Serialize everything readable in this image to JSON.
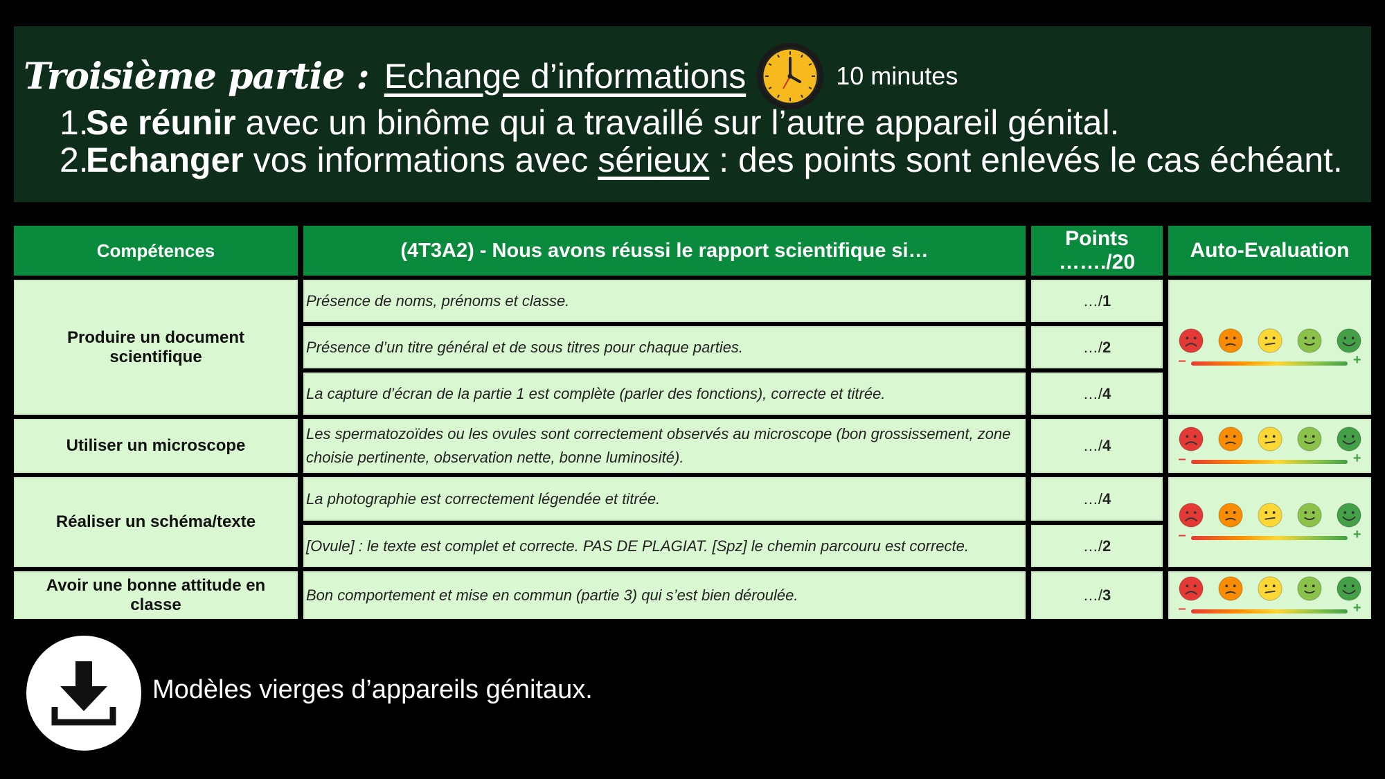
{
  "header": {
    "part_label": "Troisième partie :",
    "subject": "Echange d’informations",
    "duration": "10 minutes",
    "clock_icon": "clock-icon",
    "steps": [
      {
        "num": "1.",
        "bold": "Se réunir",
        "rest": " avec un binôme qui a travaillé sur l’autre appareil génital."
      },
      {
        "num": "2.",
        "bold": "Echanger",
        "pre": " vos informations avec ",
        "underlined": "sérieux",
        "rest": " : des points sont enlevés le cas échéant."
      }
    ]
  },
  "table": {
    "headers": {
      "competences": "Compétences",
      "criteria": "(4T3A2) - Nous avons réussi le rapport scientifique si…",
      "points": "Points ……./20",
      "self_eval": "Auto-Evaluation"
    },
    "competences": [
      "Produire un document scientifique",
      "Utiliser un microscope",
      "Réaliser un schéma/texte",
      "Avoir une bonne attitude en classe"
    ],
    "criteria": [
      {
        "text": "Présence de noms, prénoms et classe.",
        "points_prefix": "…/",
        "points_max": "1"
      },
      {
        "text": "Présence d’un titre général et de sous titres pour chaque parties.",
        "points_prefix": "…/",
        "points_max": "2"
      },
      {
        "text": "La capture d’écran de la partie 1 est complète (parler des fonctions), correcte et titrée.",
        "points_prefix": "…/",
        "points_max": "4"
      },
      {
        "text": "Les spermatozoïdes ou les ovules sont correctement observés au microscope (bon grossissement, zone choisie pertinente, observation nette, bonne luminosité).",
        "points_prefix": "…/",
        "points_max": "4"
      },
      {
        "text": "La photographie est correctement légendée et titrée.",
        "points_prefix": "…/",
        "points_max": "4"
      },
      {
        "text": "[Ovule] : le texte est complet et correcte. PAS DE PLAGIAT. [Spz] le chemin parcouru est correcte.",
        "points_prefix": "…/",
        "points_max": "2"
      },
      {
        "text": "Bon comportement et mise en commun (partie 3) qui s’est bien déroulée.",
        "points_prefix": "…/",
        "points_max": "3"
      }
    ],
    "scale": {
      "minus": "–",
      "plus": "+"
    },
    "faces": [
      {
        "icon": "very-sad-face-icon",
        "color": "#e53935"
      },
      {
        "icon": "sad-face-icon",
        "color": "#fb8c00"
      },
      {
        "icon": "neutral-face-icon",
        "color": "#fdd835"
      },
      {
        "icon": "smile-face-icon",
        "color": "#8bc34a"
      },
      {
        "icon": "happy-face-icon",
        "color": "#43a047"
      }
    ]
  },
  "footer": {
    "download_icon": "download-icon",
    "label": "Modèles vierges d’appareils génitaux."
  }
}
